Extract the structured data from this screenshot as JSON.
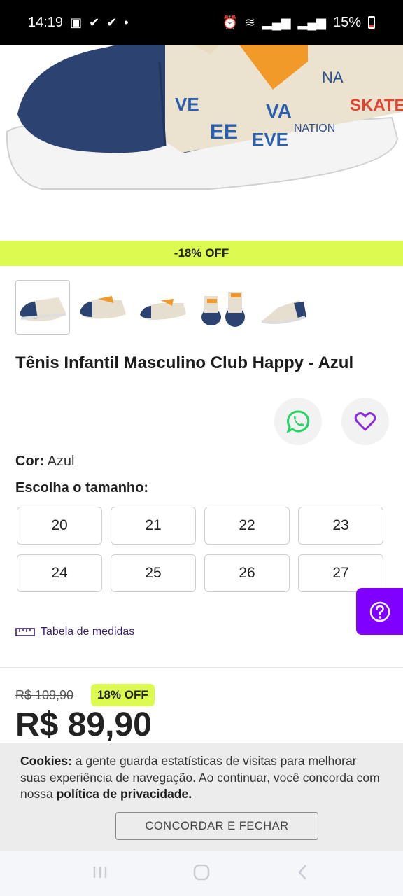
{
  "status_bar": {
    "time": "14:19",
    "battery": "15%",
    "icons": [
      "image-icon",
      "check-icon",
      "check-icon",
      "dot-icon",
      "alarm-icon",
      "wifi-icon",
      "signal-icon",
      "signal-icon",
      "battery-icon"
    ]
  },
  "product": {
    "discount_band": "-18% OFF",
    "title": "Tênis Infantil Masculino Club Happy - Azul",
    "color_label": "Cor:",
    "color_value": "Azul",
    "size_heading": "Escolha o tamanho:",
    "sizes": [
      "20",
      "21",
      "22",
      "23",
      "24",
      "25",
      "26",
      "27"
    ],
    "measure_link": "Tabela de medidas",
    "old_price": "R$ 109,90",
    "off_badge": "18% OFF",
    "price": "R$ 89,90"
  },
  "cookie": {
    "label": "Cookies:",
    "text": " a gente guarda estatísticas de visitas para melhorar suas experiência de navegação. Ao continuar, você concorda com nossa ",
    "policy_link": "política de privacidade.",
    "accept_button": "CONCORDAR E FECHAR"
  },
  "colors": {
    "accent_lime": "#dcfa50",
    "accent_purple": "#8000ff",
    "whatsapp_green": "#25d366",
    "heart_purple": "#8a2be2"
  }
}
